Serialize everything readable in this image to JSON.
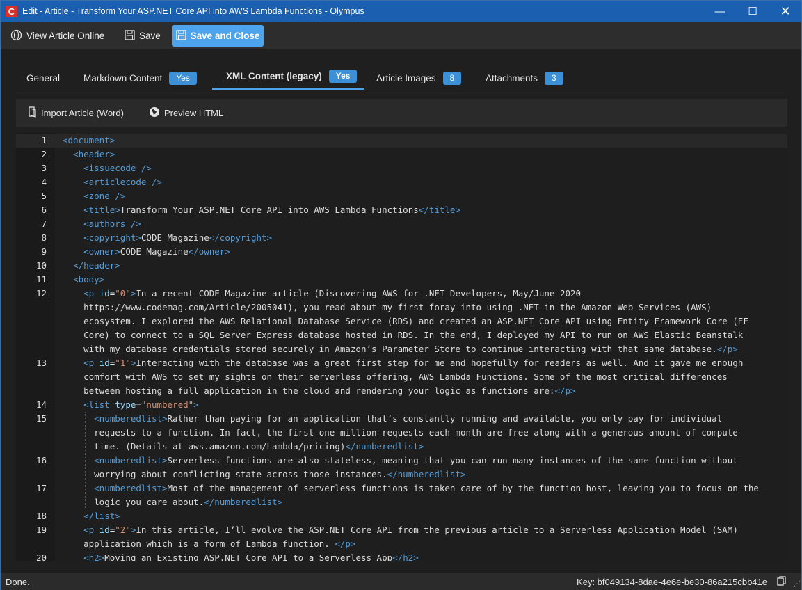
{
  "window": {
    "title": "Edit - Article - Transform Your ASP.NET Core API into AWS Lambda Functions - Olympus",
    "logo_letter": "C",
    "minimize": "—",
    "maximize": "☐",
    "close": "✕"
  },
  "toolbar": {
    "view_online": "View Article Online",
    "save": "Save",
    "save_and_close": "Save and Close"
  },
  "tabs": [
    {
      "label": "General"
    },
    {
      "label": "Markdown Content",
      "badge": "Yes"
    },
    {
      "label": "XML Content (legacy)",
      "badge": "Yes",
      "active": true
    },
    {
      "label": "Article Images",
      "badge": "8"
    },
    {
      "label": "Attachments",
      "badge": "3"
    }
  ],
  "subtoolbar": {
    "import": "Import Article (Word)",
    "preview": "Preview HTML"
  },
  "editor": {
    "line_numbers": [
      "1",
      "2",
      "3",
      "4",
      "5",
      "6",
      "7",
      "8",
      "9",
      "10",
      "11",
      "12",
      "13",
      "14",
      "15",
      "16",
      "17",
      "18",
      "19",
      "20"
    ],
    "lines": [
      "<document>",
      "  <header>",
      "    <issuecode />",
      "    <articlecode />",
      "    <zone />",
      "    <title>Transform Your ASP.NET Core API into AWS Lambda Functions</title>",
      "    <authors />",
      "    <copyright>CODE Magazine</copyright>",
      "    <owner>CODE Magazine</owner>",
      "  </header>",
      "  <body>",
      "    <p id=\"0\">In a recent CODE Magazine article (Discovering AWS for .NET Developers, May/June 2020",
      "    https://www.codemag.com/Article/2005041), you read about my first foray into using .NET in the Amazon Web Services (AWS)",
      "    ecosystem. I explored the AWS Relational Database Service (RDS) and created an ASP.NET Core API using Entity Framework Core (EF",
      "    Core) to connect to a SQL Server Express database hosted in RDS. In the end, I deployed my API to run on AWS Elastic Beanstalk",
      "    with my database credentials stored securely in Amazon’s Parameter Store to continue interacting with that same database.</p>",
      "    <p id=\"1\">Interacting with the database was a great first step for me and hopefully for readers as well. And it gave me enough",
      "    comfort with AWS to set my sights on their serverless offering, AWS Lambda Functions. Some of the most critical differences",
      "    between hosting a full application in the cloud and rendering your logic as functions are:</p>",
      "    <list type=\"numbered\">",
      "      <numberedlist>Rather than paying for an application that’s constantly running and available, you only pay for individual",
      "      requests to a function. In fact, the first one million requests each month are free along with a generous amount of compute",
      "      time. (Details at aws.amazon.com/Lambda/pricing)</numberedlist>",
      "      <numberedlist>Serverless functions are also stateless, meaning that you can run many instances of the same function without",
      "      worrying about conflicting state across those instances.</numberedlist>",
      "      <numberedlist>Most of the management of serverless functions is taken care of by the function host, leaving you to focus on the",
      "      logic you care about.</numberedlist>",
      "    </list>",
      "    <p id=\"2\">In this article, I’ll evolve the ASP.NET Core API from the previous article to a Serverless Application Model (SAM)",
      "    application which is a form of Lambda function. </p>",
      "    <h2>Moving an Existing ASP.NET Core API to a Serverless App</h2>"
    ]
  },
  "status": {
    "left": "Done.",
    "key": "Key: bf049134-8dae-4e6e-be30-86a215cbb41e"
  }
}
